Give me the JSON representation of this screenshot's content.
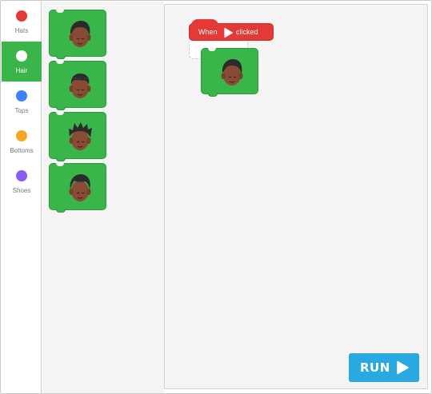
{
  "sidebar": {
    "categories": [
      {
        "label": "Hats",
        "color": "#e53935",
        "icon": "hats-category-dot"
      },
      {
        "label": "Hair",
        "color": "#ffffff",
        "icon": "hair-category-dot",
        "active": true
      },
      {
        "label": "Tops",
        "color": "#3b82f6",
        "icon": "tops-category-dot"
      },
      {
        "label": "Bottoms",
        "color": "#f5a623",
        "icon": "bottoms-category-dot"
      },
      {
        "label": "Shoes",
        "color": "#8b5cf6",
        "icon": "shoes-category-dot"
      }
    ],
    "active_color": "#3ab54a"
  },
  "palette": {
    "blocks": [
      {
        "icon": "short-hair-icon"
      },
      {
        "icon": "wavy-hair-icon"
      },
      {
        "icon": "spiky-hair-icon"
      },
      {
        "icon": "side-part-hair-icon"
      }
    ]
  },
  "workspace": {
    "hat_block": {
      "when_label": "When",
      "clicked_label": "clicked",
      "flag_icon": "play-flag-icon",
      "color": "#e53935"
    },
    "attached_block": {
      "icon": "short-hair-icon"
    }
  },
  "run_button": {
    "label": "RUN",
    "icon": "play-icon",
    "color": "#29a9e0"
  }
}
